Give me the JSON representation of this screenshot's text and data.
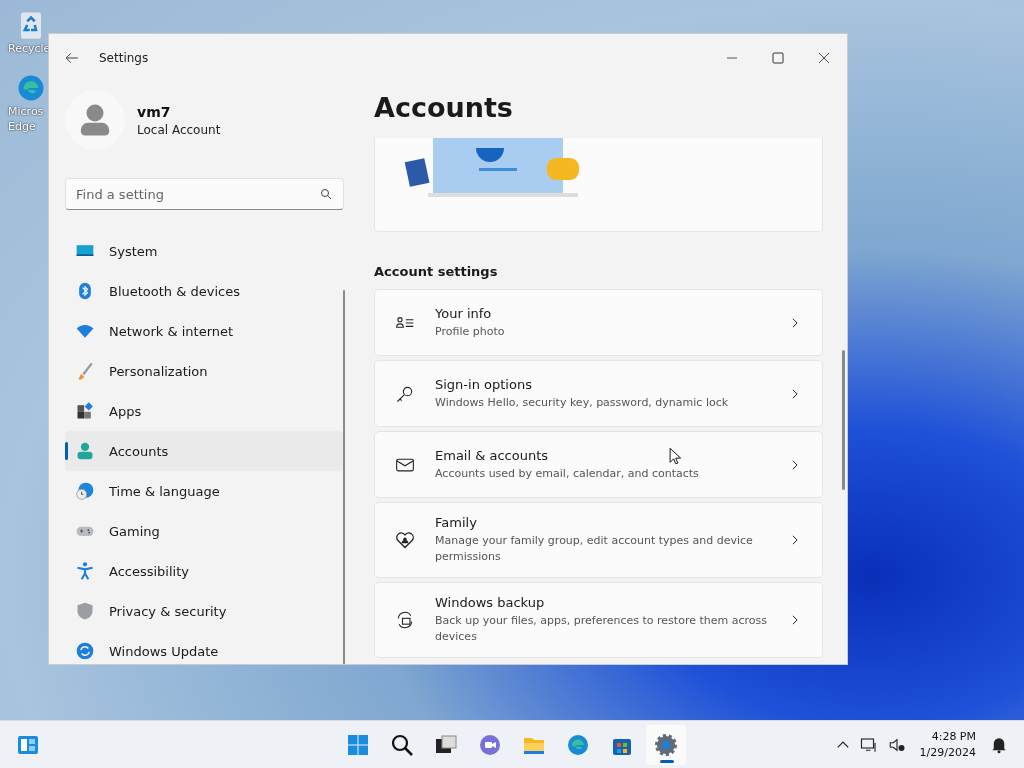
{
  "desktop_icons": [
    {
      "kind": "recycle",
      "labels": [
        "Recycle"
      ]
    },
    {
      "kind": "edge",
      "labels": [
        "Micros",
        "Edge"
      ]
    }
  ],
  "window": {
    "title": "Settings"
  },
  "user": {
    "name": "vm7",
    "account_type": "Local Account"
  },
  "search": {
    "placeholder": "Find a setting"
  },
  "nav_items": [
    {
      "label": "System",
      "kind": "system",
      "selected": false
    },
    {
      "label": "Bluetooth & devices",
      "kind": "bluetooth",
      "selected": false
    },
    {
      "label": "Network & internet",
      "kind": "network",
      "selected": false
    },
    {
      "label": "Personalization",
      "kind": "brush",
      "selected": false
    },
    {
      "label": "Apps",
      "kind": "apps",
      "selected": false
    },
    {
      "label": "Accounts",
      "kind": "accounts",
      "selected": true
    },
    {
      "label": "Time & language",
      "kind": "time",
      "selected": false
    },
    {
      "label": "Gaming",
      "kind": "gaming",
      "selected": false
    },
    {
      "label": "Accessibility",
      "kind": "accessibility",
      "selected": false
    },
    {
      "label": "Privacy & security",
      "kind": "shield",
      "selected": false
    },
    {
      "label": "Windows Update",
      "kind": "update",
      "selected": false
    }
  ],
  "page_title": "Accounts",
  "section_heading": "Account settings",
  "settings": [
    {
      "kind": "info",
      "title": "Your info",
      "subtitle": "Profile photo"
    },
    {
      "kind": "key",
      "title": "Sign-in options",
      "subtitle": "Windows Hello, security key, password, dynamic lock"
    },
    {
      "kind": "mail",
      "title": "Email & accounts",
      "subtitle": "Accounts used by email, calendar, and contacts"
    },
    {
      "kind": "family",
      "title": "Family",
      "subtitle": "Manage your family group, edit account types and device permissions"
    },
    {
      "kind": "backup",
      "title": "Windows backup",
      "subtitle": "Back up your files, apps, preferences to restore them across devices"
    }
  ],
  "taskbar": {
    "apps": [
      {
        "kind": "start",
        "active": false
      },
      {
        "kind": "search",
        "active": false
      },
      {
        "kind": "taskview",
        "active": false
      },
      {
        "kind": "chat",
        "active": false
      },
      {
        "kind": "folder",
        "active": false
      },
      {
        "kind": "edge",
        "active": false
      },
      {
        "kind": "store",
        "active": false
      },
      {
        "kind": "settings",
        "active": true
      }
    ],
    "time": "4:28 PM",
    "date": "1/29/2024"
  }
}
